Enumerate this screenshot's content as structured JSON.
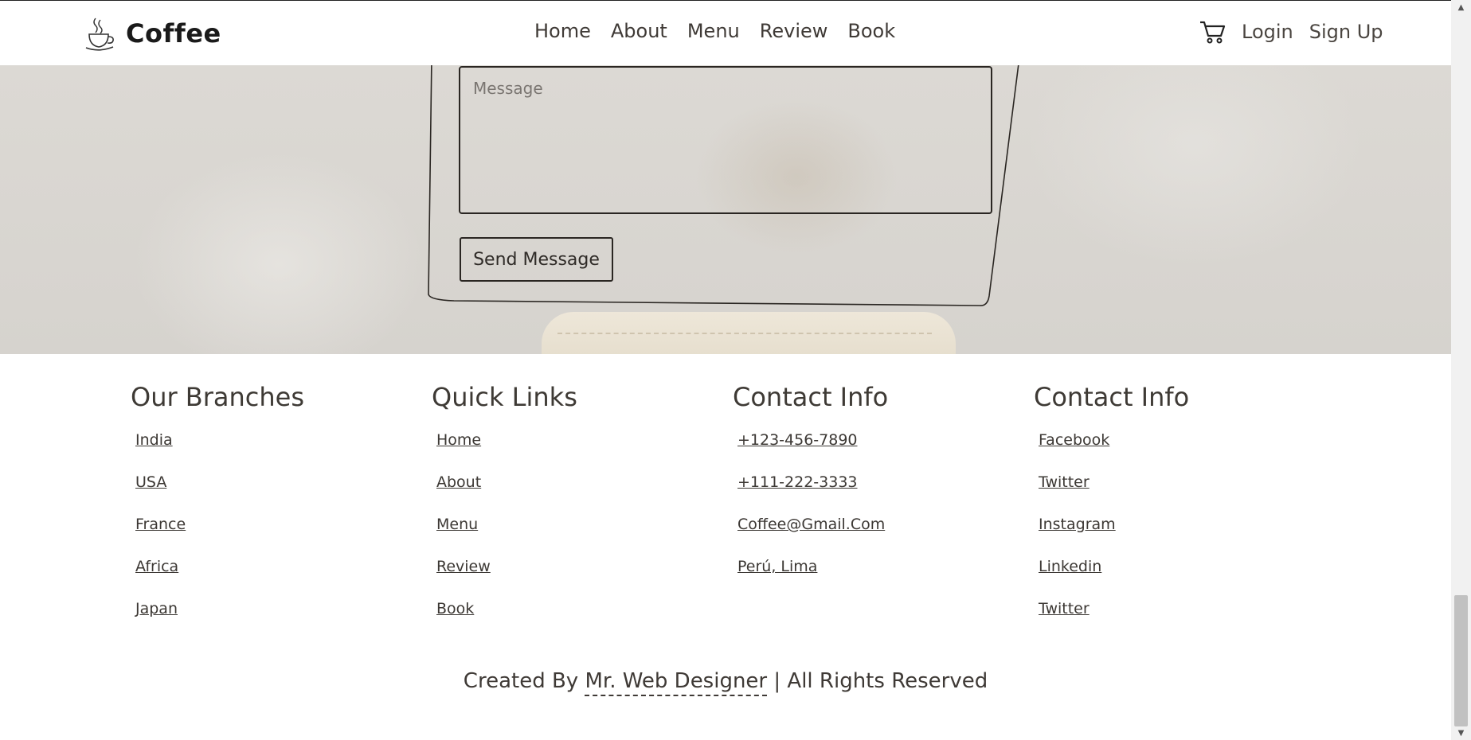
{
  "header": {
    "brand": "Coffee",
    "nav": [
      "Home",
      "About",
      "Menu",
      "Review",
      "Book"
    ],
    "login": "Login",
    "signup": "Sign Up"
  },
  "form": {
    "message_placeholder": "Message",
    "send_label": "Send Message"
  },
  "footer": {
    "branches": {
      "title": "Our Branches",
      "links": [
        "India",
        "USA",
        "France",
        "Africa",
        "Japan"
      ]
    },
    "quick_links": {
      "title": "Quick Links",
      "links": [
        "Home",
        "About",
        "Menu",
        "Review",
        "Book"
      ]
    },
    "contact": {
      "title": "Contact Info",
      "links": [
        "+123-456-7890",
        "+111-222-3333",
        "Coffee@Gmail.Com",
        "Perú, Lima"
      ]
    },
    "social": {
      "title": "Contact Info",
      "links": [
        "Facebook",
        "Twitter",
        "Instagram",
        "Linkedin",
        "Twitter"
      ]
    },
    "credit_prefix": "Created By",
    "credit_name": "Mr. Web Designer",
    "credit_suffix": "| All Rights Reserved"
  },
  "colors": {
    "text": "#3a3530",
    "background_texture": "#d9d6d1"
  },
  "icons": [
    "coffee-cup-icon",
    "cart-icon",
    "scroll-up-arrow-icon",
    "scroll-down-arrow-icon"
  ]
}
